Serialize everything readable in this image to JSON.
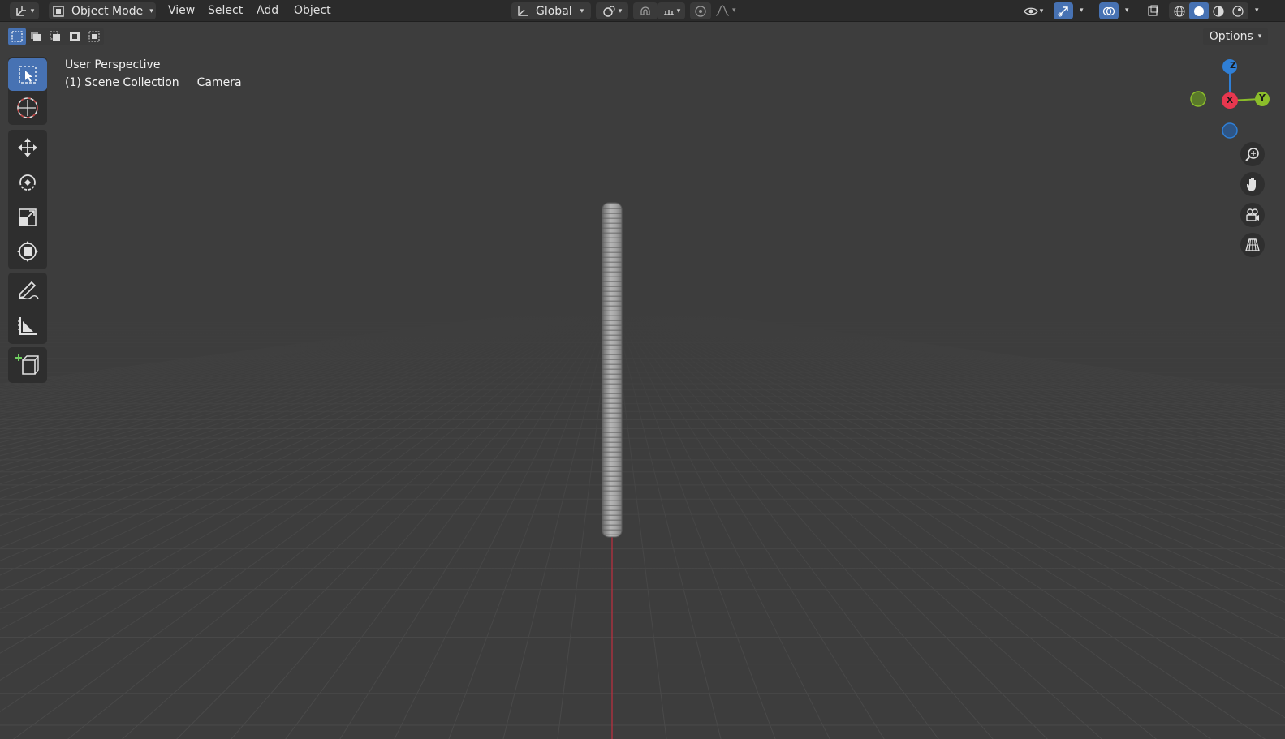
{
  "header": {
    "mode_label": "Object Mode",
    "menus": [
      "View",
      "Select",
      "Add",
      "Object"
    ],
    "transform_orientation": "Global",
    "options_label": "Options"
  },
  "viewport": {
    "view_name": "User Perspective",
    "collection_label": "(1) Scene Collection",
    "active_object": "Camera"
  },
  "gizmo": {
    "z_label": "Z",
    "x_label": "X",
    "y_label": "Y",
    "colors": {
      "x": "#e8374f",
      "y": "#8bbd2a",
      "z": "#2f7fd6"
    }
  },
  "tools": [
    "select-box-tool",
    "cursor-tool",
    "move-tool",
    "rotate-tool",
    "scale-tool",
    "transform-tool",
    "annotate-tool",
    "measure-tool",
    "add-cube-tool"
  ],
  "colors": {
    "accent": "#4772b3",
    "background": "#3d3d3d",
    "header": "#2b2b2b"
  }
}
